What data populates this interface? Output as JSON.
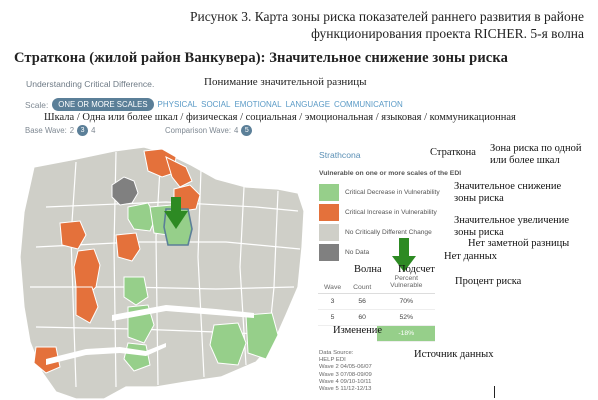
{
  "caption": "Рисунок 3.  Карта зоны риска показателей раннего развития в районе функционирования проекта RICHER. 5-я волна",
  "heading": "Страткона (жилой район Ванкувера): Значительное снижение зоны риска",
  "app": {
    "title": "Understanding Critical Difference.",
    "title_translation": "Понимание значительной разницы"
  },
  "scale": {
    "label": "Scale:",
    "options": [
      "ONE OR MORE SCALES",
      "PHYSICAL",
      "SOCIAL",
      "EMOTIONAL",
      "LANGUAGE",
      "COMMUNICATION"
    ],
    "translation": "Шкала / Одна или более шкал / физическая / социальная / эмоциональная / языковая / коммуникационная"
  },
  "base_wave": {
    "label": "Base Wave:",
    "values": [
      "2",
      "3",
      "4"
    ],
    "selected": "3"
  },
  "comparison_wave": {
    "label": "Comparison Wave:",
    "values": [
      "4",
      "5"
    ],
    "selected": "5"
  },
  "legend": {
    "neighbourhood": "Strathcona",
    "neighbourhood_tr": "Страткона",
    "subtitle": "Vulnerable on one or more scales of the EDI",
    "subtitle_tr": "Зона риска по одной или более шкал",
    "items": [
      {
        "label": "Critical Decrease in Vulnerability",
        "color": "#96cf8a",
        "tr": "Значительное снижение зоны риска"
      },
      {
        "label": "Critical Increase in Vulnerability",
        "color": "#e4713b",
        "tr": "Значительное увеличение зоны риска"
      },
      {
        "label": "No Critically Different Change",
        "color": "#cfcfc8",
        "tr": "Нет заметной разницы"
      },
      {
        "label": "No Data",
        "color": "#808080",
        "tr": "Нет данных"
      }
    ]
  },
  "table": {
    "headers": [
      "Wave",
      "Count",
      "Percent Vulnerable"
    ],
    "header_tr": {
      "wave": "Волна",
      "count": "Подсчет",
      "percent": "Процент риска"
    },
    "rows": [
      {
        "wave": "3",
        "count": "56",
        "percent": "70%"
      },
      {
        "wave": "5",
        "count": "60",
        "percent": "52%"
      }
    ],
    "change_label_tr": "Изменение",
    "change_value": "-18%"
  },
  "data_source": {
    "lines": [
      "Data Source:",
      "HELP EDI",
      "Wave 2 04/05-06/07",
      "Wave 3 07/08-09/09",
      "Wave 4 09/10-10/11",
      "Wave 5 11/12-12/13"
    ],
    "translation": "Источник данных"
  }
}
